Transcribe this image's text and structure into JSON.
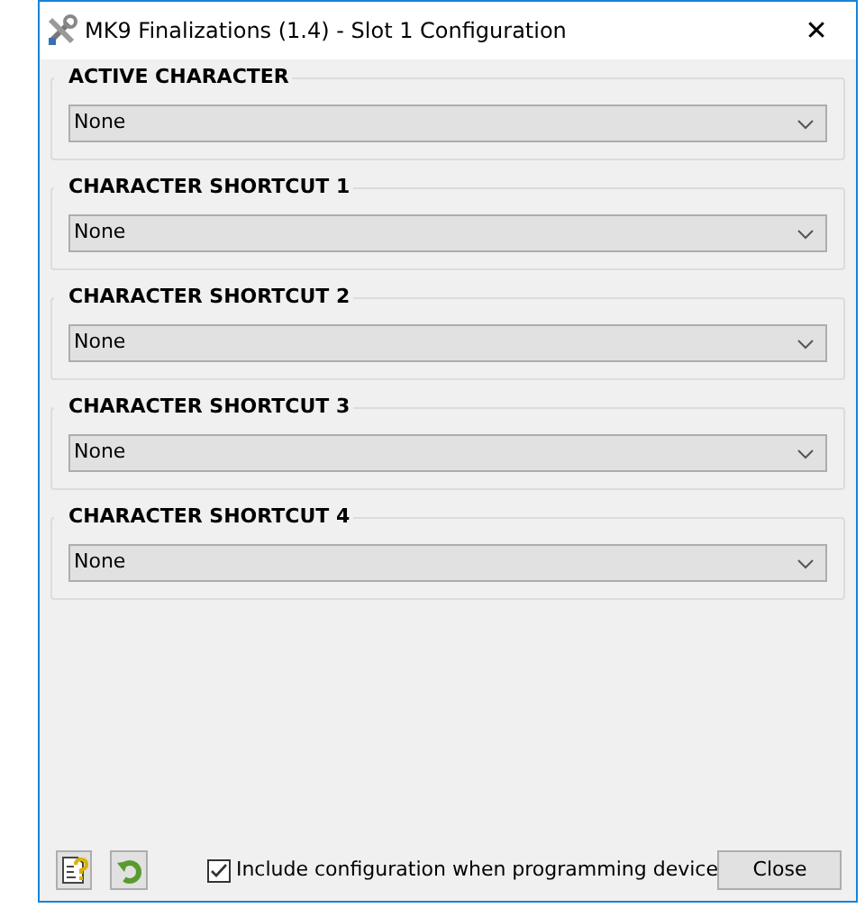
{
  "window": {
    "title": "MK9 Finalizations (1.4) - Slot 1 Configuration",
    "close": "✕"
  },
  "groups": [
    {
      "label": "ACTIVE CHARACTER",
      "value": "None"
    },
    {
      "label": "CHARACTER SHORTCUT 1",
      "value": "None"
    },
    {
      "label": "CHARACTER SHORTCUT 2",
      "value": "None"
    },
    {
      "label": "CHARACTER SHORTCUT 3",
      "value": "None"
    },
    {
      "label": "CHARACTER SHORTCUT 4",
      "value": "None"
    }
  ],
  "footer": {
    "include": {
      "label": "Include configuration when programming device",
      "checked": true
    },
    "close_button": "Close"
  }
}
